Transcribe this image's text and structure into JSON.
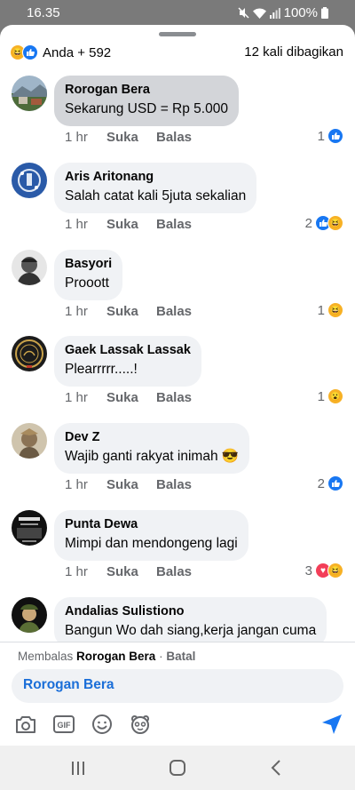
{
  "status_bar": {
    "time": "16.35",
    "battery": "100%"
  },
  "header": {
    "reaction_icons": [
      "haha-icon",
      "like-icon"
    ],
    "reactors_label": "Anda + 592",
    "shares_label": "12 kali dibagikan"
  },
  "colors": {
    "like_blue": "#1877f2",
    "haha_yellow": "#f7b125",
    "love_red": "#f33e58",
    "link_blue": "#1a6ed8",
    "bubble_gray": "#f0f2f5"
  },
  "comments": [
    {
      "author": "Rorogan Bera",
      "text": "Sekarung USD = Rp 5.000",
      "time": "1 hr",
      "like": "Suka",
      "reply": "Balas",
      "reaction_count": "1",
      "reactions": [
        "like"
      ],
      "selected": true
    },
    {
      "author": "Aris Aritonang",
      "text": "Salah catat kali 5juta sekalian",
      "time": "1 hr",
      "like": "Suka",
      "reply": "Balas",
      "reaction_count": "2",
      "reactions": [
        "like",
        "haha"
      ]
    },
    {
      "author": "Basyori",
      "text": "Prooott",
      "time": "1 hr",
      "like": "Suka",
      "reply": "Balas",
      "reaction_count": "1",
      "reactions": [
        "haha"
      ]
    },
    {
      "author": "Gaek Lassak Lassak",
      "text": "Plearrrrr.....!",
      "time": "1 hr",
      "like": "Suka",
      "reply": "Balas",
      "reaction_count": "1",
      "reactions": [
        "wow"
      ]
    },
    {
      "author": "Dev Z",
      "text": "Wajib ganti rakyat inimah 😎",
      "time": "1 hr",
      "like": "Suka",
      "reply": "Balas",
      "reaction_count": "2",
      "reactions": [
        "like"
      ]
    },
    {
      "author": "Punta Dewa",
      "text": "Mimpi dan mendongeng lagi",
      "time": "1 hr",
      "like": "Suka",
      "reply": "Balas",
      "reaction_count": "3",
      "reactions": [
        "love",
        "haha"
      ]
    },
    {
      "author": "Andalias Sulistiono",
      "text": "Bangun Wo dah siang,kerja jangan cuma"
    }
  ],
  "reply_bar": {
    "prefix": "Membalas",
    "target": "Rorogan Bera",
    "separator": " · ",
    "cancel": "Batal",
    "input_tag": "Rorogan Bera",
    "tools": [
      "camera-icon",
      "gif-icon",
      "emoji-icon",
      "sticker-icon"
    ],
    "send_icon": "send-icon"
  },
  "nav_bar": {
    "buttons": [
      "recents-icon",
      "home-icon",
      "back-icon"
    ]
  }
}
